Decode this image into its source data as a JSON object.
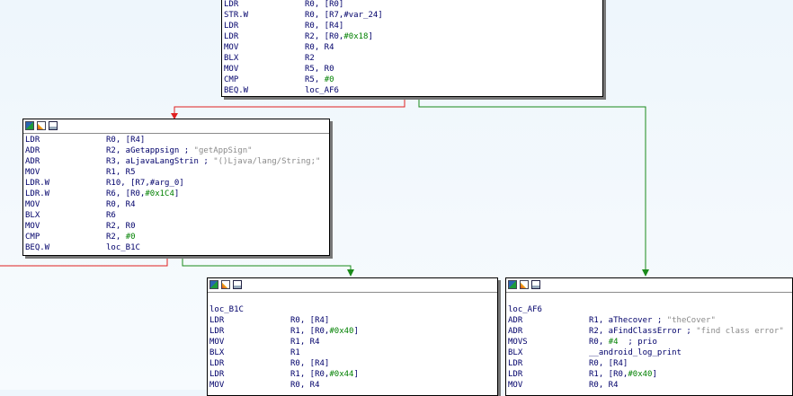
{
  "colors": {
    "false_edge": "#e02020",
    "true_edge": "#1a8a1a",
    "comment": "#8a8a8a",
    "number": "#008000",
    "text": "#00006a"
  },
  "header_icons": [
    "graph-overview-icon",
    "color-icon",
    "text-view-icon"
  ],
  "node_top": {
    "rows": [
      {
        "mn": "LDR",
        "op": "R0, [R0]",
        "cm": ""
      },
      {
        "mn": "STR.W",
        "op": "R0, [R7,#var_24]",
        "cm": ""
      },
      {
        "mn": "LDR",
        "op": "R0, [R4]",
        "cm": ""
      },
      {
        "mn": "LDR",
        "op": "R2, [R0,#0x18]",
        "cm": ""
      },
      {
        "mn": "MOV",
        "op": "R0, R4",
        "cm": ""
      },
      {
        "mn": "BLX",
        "op": "R2",
        "cm": ""
      },
      {
        "mn": "MOV",
        "op": "R5, R0",
        "cm": ""
      },
      {
        "mn": "CMP",
        "op": "R5, #0",
        "cm": ""
      },
      {
        "mn": "BEQ.W",
        "op": "loc_AF6",
        "cm": ""
      }
    ]
  },
  "node_left": {
    "rows": [
      {
        "mn": "LDR",
        "op": "R0, [R4]",
        "cm": ""
      },
      {
        "mn": "ADR",
        "op": "R2, aGetappsign ;",
        "cm": " \"getAppSign\""
      },
      {
        "mn": "ADR",
        "op": "R3, aLjavaLangStrin ;",
        "cm": " \"()Ljava/lang/String;\""
      },
      {
        "mn": "MOV",
        "op": "R1, R5",
        "cm": ""
      },
      {
        "mn": "LDR.W",
        "op": "R10, [R7,#arg_0]",
        "cm": ""
      },
      {
        "mn": "LDR.W",
        "op": "R6, [R0,#0x1C4]",
        "cm": ""
      },
      {
        "mn": "MOV",
        "op": "R0, R4",
        "cm": ""
      },
      {
        "mn": "BLX",
        "op": "R6",
        "cm": ""
      },
      {
        "mn": "MOV",
        "op": "R2, R0",
        "cm": ""
      },
      {
        "mn": "CMP",
        "op": "R2, #0",
        "cm": ""
      },
      {
        "mn": "BEQ.W",
        "op": "loc_B1C",
        "cm": ""
      }
    ]
  },
  "node_b1c": {
    "label": "loc_B1C",
    "rows": [
      {
        "mn": "LDR",
        "op": "R0, [R4]",
        "cm": ""
      },
      {
        "mn": "LDR",
        "op": "R1, [R0,#0x40]",
        "cm": ""
      },
      {
        "mn": "MOV",
        "op": "R1, R4",
        "cm": ""
      },
      {
        "mn": "BLX",
        "op": "R1",
        "cm": ""
      },
      {
        "mn": "LDR",
        "op": "R0, [R4]",
        "cm": ""
      },
      {
        "mn": "LDR",
        "op": "R1, [R0,#0x44]",
        "cm": ""
      },
      {
        "mn": "MOV",
        "op": "R0, R4",
        "cm": ""
      }
    ]
  },
  "node_af6": {
    "label": "loc_AF6",
    "rows": [
      {
        "mn": "ADR",
        "op": "R1, aThecover ;",
        "cm": " \"theCover\""
      },
      {
        "mn": "ADR",
        "op": "R2, aFindClassError ;",
        "cm": " \"find class error\""
      },
      {
        "mn": "MOVS",
        "op": "R0, #4  ; prio",
        "cm": ""
      },
      {
        "mn": "BLX",
        "op": "__android_log_print",
        "cm": ""
      },
      {
        "mn": "LDR",
        "op": "R0, [R4]",
        "cm": ""
      },
      {
        "mn": "LDR",
        "op": "R1, [R0,#0x40]",
        "cm": ""
      },
      {
        "mn": "MOV",
        "op": "R0, R4",
        "cm": ""
      }
    ]
  }
}
